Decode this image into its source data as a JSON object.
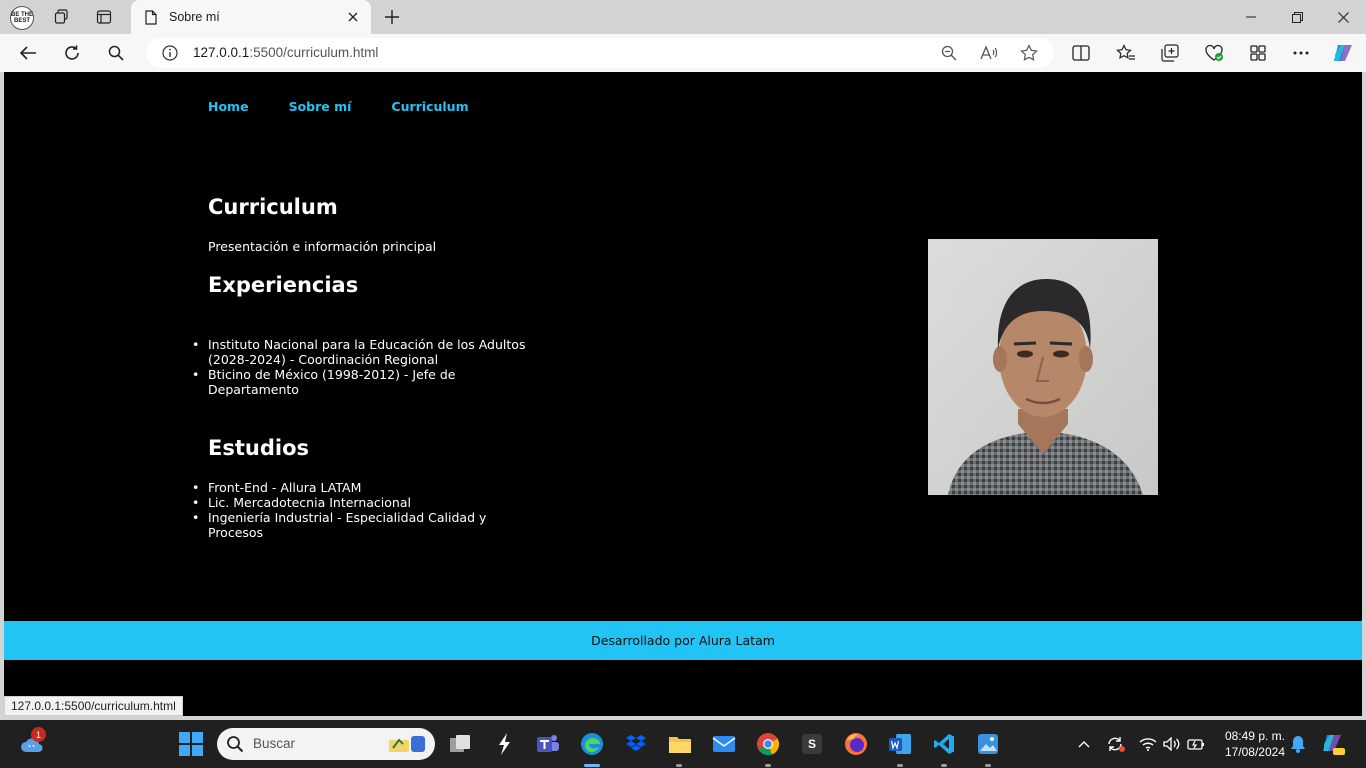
{
  "browser": {
    "profile_label": "BE THE BEST",
    "tab_title": "Sobre mí",
    "url_host": "127.0.0.1",
    "url_rest": ":5500/curriculum.html",
    "status_url": "127.0.0.1:5500/curriculum.html"
  },
  "page": {
    "nav": [
      "Home",
      "Sobre mí",
      "Curriculum"
    ],
    "title": "Curriculum",
    "subtitle": "Presentación e información principal",
    "experience_title": "Experiencias",
    "experience": [
      "Instituto Nacional para la Educación de los Adultos (2028-2024) - Coordinación Regional",
      "Bticino de México (1998-2012) - Jefe de Departamento"
    ],
    "studies_title": "Estudios",
    "studies": [
      "Front-End - Allura LATAM",
      "Lic. Mercadotecnia Internacional",
      "Ingeniería Industrial - Especialidad Calidad y Procesos"
    ],
    "footer": "Desarrollado por Alura Latam",
    "accent_color": "#22c4f5"
  },
  "taskbar": {
    "search_placeholder": "Buscar",
    "weather_badge": "1",
    "time": "08:49 p. m.",
    "date": "17/08/2024",
    "app_s_letter": "S"
  }
}
